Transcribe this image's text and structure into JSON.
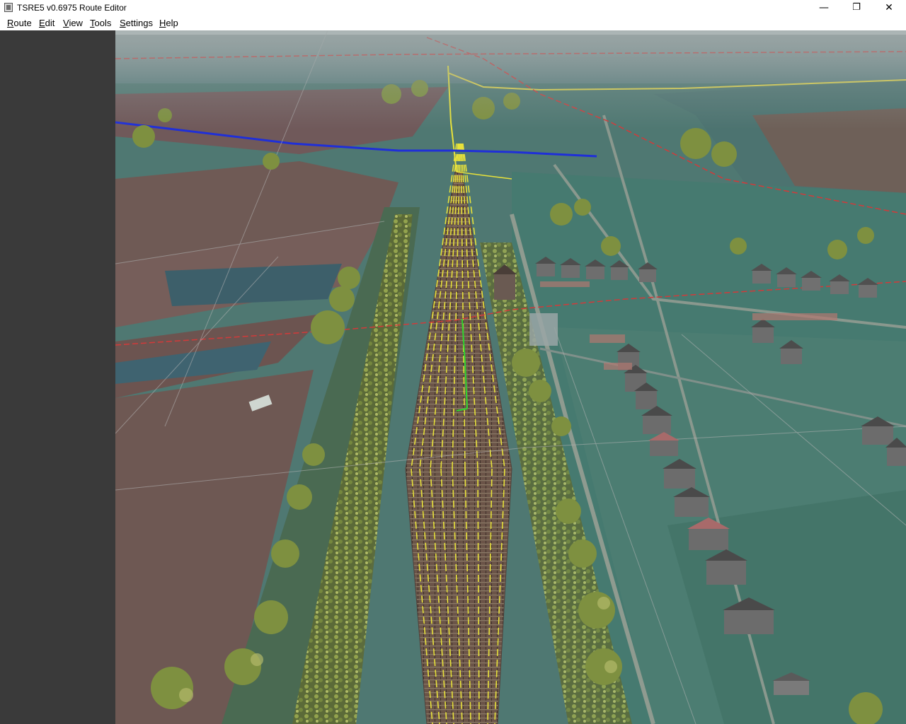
{
  "window": {
    "title": "TSRE5 v0.6975 Route Editor",
    "controls": {
      "minimize": "—",
      "maximize": "❐",
      "close": "✕"
    }
  },
  "menu": [
    {
      "label": "Route",
      "mnemonic": "R",
      "rest": "oute"
    },
    {
      "label": "Edit",
      "mnemonic": "E",
      "rest": "dit"
    },
    {
      "label": "View",
      "mnemonic": "V",
      "rest": "iew"
    },
    {
      "label": "Tools",
      "mnemonic": "T",
      "rest": "ools"
    },
    {
      "label": "Settings",
      "mnemonic": "S",
      "rest": "ettings"
    },
    {
      "label": "Help",
      "mnemonic": "H",
      "rest": "elp"
    }
  ],
  "colors": {
    "sidebar": "#3a3a3a",
    "farmland": "#6f5a55",
    "fields_teal": "#3f6f68",
    "town_green": "#4a7a72",
    "track_yellow": "#e8e23a",
    "boundary_red": "#d23a3a",
    "line_blue": "#1f2fd8",
    "selected_green": "#2fd52f"
  },
  "icons": [
    "app-icon",
    "minimize-icon",
    "maximize-icon",
    "close-icon"
  ]
}
